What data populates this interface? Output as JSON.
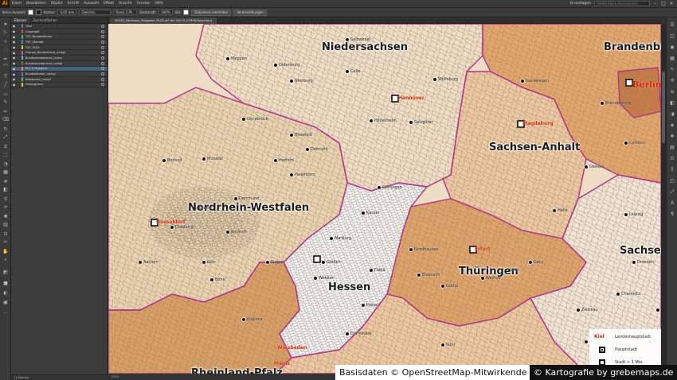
{
  "app": {
    "logo": "Ai",
    "menu": [
      "Datei",
      "Bearbeiten",
      "Objekt",
      "Schrift",
      "Auswahl",
      "Effekt",
      "Ansicht",
      "Fenster",
      "Hilfe"
    ],
    "workspace": "Grundlagen",
    "stock_search": "Adobe Stock durchsuchen"
  },
  "control_bar": {
    "selection": "Keine Auswahl",
    "stroke_label": "Kontur:",
    "stroke_value": "0,05 mm",
    "profile_label": "Gleichm.",
    "brush_label": "Rund, 5 Pt.",
    "opacity_label": "Deckkraft:",
    "opacity_value": "100%",
    "style_label": "Stil:",
    "doc_setup_button": "Dokument einrichten",
    "preferences_button": "Voreinstellungen"
  },
  "layers_panel": {
    "tabs": [
      "Ebenen",
      "Zeichenflächen"
    ],
    "layers": [
      {
        "name": "Titel",
        "color": "#4f7ccf",
        "selected": false
      },
      {
        "name": "Copyright",
        "color": "#d94a4a",
        "selected": false
      },
      {
        "name": "TXT_Bundesländer",
        "color": "#4fae4f",
        "selected": false
      },
      {
        "name": "TXT_Staedte",
        "color": "#3a8ed8",
        "selected": false
      },
      {
        "name": "TXT_PLZ5",
        "color": "#e2c23a",
        "selected": false
      },
      {
        "name": "Grenze_Deutschland_umkpl",
        "color": "#c94ad0",
        "selected": false
      },
      {
        "name": "Bundeslandgrenze_Linien",
        "color": "#48c2c2",
        "selected": false
      },
      {
        "name": "Bundeslandgrenze_umkpl",
        "color": "#6f6f6f",
        "selected": false
      },
      {
        "name": "PLZ 5-Polygone",
        "color": "#e28d3a",
        "selected": true
      },
      {
        "name": "Bundesländer_umkpl",
        "color": "#8a5fd0",
        "selected": false
      },
      {
        "name": "Basiskarte_umkpl",
        "color": "#3ac27a",
        "selected": false
      },
      {
        "name": "Hintergrund",
        "color": "#d2d24a",
        "selected": false
      }
    ],
    "footer": "11 Ebenen"
  },
  "document": {
    "tab_title": "50042_Germany_Polygone_PLZ5.ai* bei 100 % (CMYK/Vorschau)",
    "status": "100%"
  },
  "map": {
    "states": [
      {
        "name": "Niedersachsen"
      },
      {
        "name": "Brandenburg"
      },
      {
        "name": "Sachsen-Anhalt"
      },
      {
        "name": "Nordrhein-Westfalen"
      },
      {
        "name": "Hessen"
      },
      {
        "name": "Thüringen"
      },
      {
        "name": "Sachsen"
      },
      {
        "name": "Rheinland-Pfalz"
      }
    ],
    "capitals": [
      "Hannover",
      "Magdeburg",
      "Berlin",
      "Düsseldorf",
      "Erfurt",
      "Wiesbaden",
      "Mainz"
    ],
    "cities": [
      "Meppen",
      "Oldenburg",
      "Nienburg",
      "Celle",
      "Salzwedel",
      "Hildesheim",
      "Salzgitter",
      "Wolfsburg",
      "Göttingen",
      "Halle",
      "Leipzig",
      "Dessau",
      "Dresden",
      "Chemnitz",
      "Zwickau",
      "Gera",
      "Jena",
      "Weimar",
      "Gotha",
      "Eisenach",
      "Kassel",
      "Fulda",
      "Marburg",
      "Gießen",
      "Paderborn",
      "Bielefeld",
      "Detmold",
      "Osnabrück",
      "Münster",
      "Bocholt",
      "Dortmund",
      "Essen",
      "Duisburg",
      "Bochum",
      "Köln",
      "Bonn",
      "Siegen",
      "Koblenz",
      "Aachen",
      "Brandenburg",
      "Nordhausen",
      "Gardelegen",
      "Cottbus",
      "Bautzen",
      "Görlitz",
      "Herford",
      "Wetzlar",
      "Darmstadt",
      "Hanau",
      "Plauen",
      "Suhl"
    ],
    "colors": {
      "nrw": "#ead2b0",
      "niedersachsen": "#efdcc4",
      "hessen": "#f6f6f6",
      "thueringen": "#dfa36a",
      "sachsen_anhalt": "#ecc7a0",
      "brandenburg": "#e3a66a",
      "berlin": "#c87b45",
      "sachsen": "#f1e4d4",
      "rheinland_pfalz": "#d99e64",
      "border": "#b0348a",
      "capital_text": "#d32a00"
    }
  },
  "legend": [
    {
      "key": "Kiel",
      "text": "Landeshauptstadt"
    },
    {
      "key": "",
      "text": "Hauptstadt"
    },
    {
      "key": "",
      "text": "Stadt > 1 Mio."
    }
  ],
  "credits": {
    "left": "Basisdaten © OpenStreetMap-Mitwirkende",
    "right": "© Kartografie by grebemaps.de"
  }
}
